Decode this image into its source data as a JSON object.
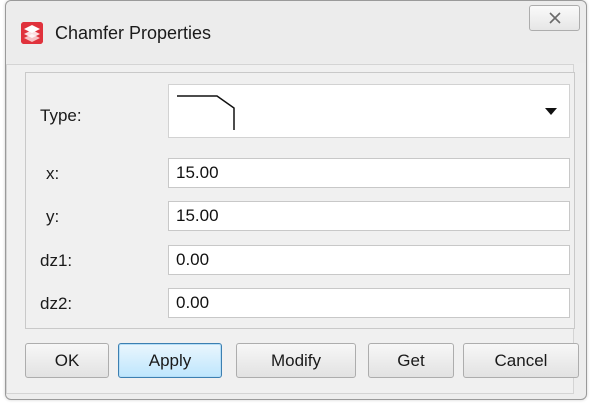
{
  "window": {
    "title": "Chamfer Properties",
    "accent_color": "#e0323c"
  },
  "form": {
    "type_label": "Type:",
    "type_selected_icon": "chamfer-profile-icon",
    "fields": [
      {
        "label": "x:",
        "value": "15.00"
      },
      {
        "label": "y:",
        "value": "15.00"
      },
      {
        "label": "dz1:",
        "value": "0.00"
      },
      {
        "label": "dz2:",
        "value": "0.00"
      }
    ]
  },
  "buttons": {
    "ok": "OK",
    "apply": "Apply",
    "modify": "Modify",
    "get": "Get",
    "cancel": "Cancel"
  }
}
